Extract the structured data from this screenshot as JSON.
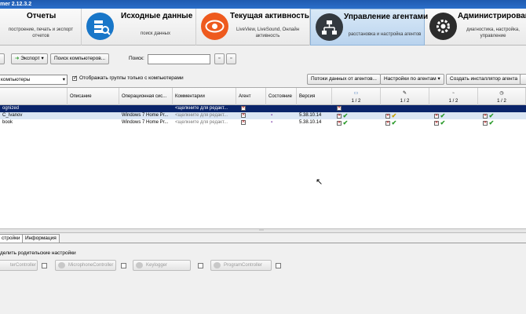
{
  "window": {
    "title": "mer 2.12.3.2"
  },
  "ribbon": {
    "tabs": [
      {
        "title": "Отчеты",
        "subtitle": "построение, печать и экспорт отчетов",
        "icon": "none"
      },
      {
        "title": "Исходные данные",
        "subtitle": "поиск данных",
        "icon": "search-database-icon"
      },
      {
        "title": "Текущая активность",
        "subtitle": "LiveView, LiveSound, Онлайн активность",
        "icon": "eye-icon"
      },
      {
        "title": "Управление агентами",
        "subtitle": "расстановка и настройка агентов",
        "icon": "network-icon",
        "active": true
      },
      {
        "title": "Администрировани",
        "subtitle": "диагностика, настройка, управление",
        "icon": "gear-icon"
      }
    ]
  },
  "toolbar": {
    "export_label": "Экспорт",
    "search_computers_label": "Поиск компьютеров...",
    "search_label": "Поиск:",
    "search_value": "",
    "view_select_value": "компьютеры",
    "show_groups_label": "Отображать группы только с компьютерами",
    "show_groups_checked": true,
    "agent_data_streams_label": "Потоки данных от агентов...",
    "agent_settings_label": "Настройки по агентам",
    "create_installer_label": "Создать инсталлятор агента"
  },
  "table": {
    "columns": [
      "Описание",
      "Операционная сис...",
      "Комментарии",
      "Агент",
      "Состояние",
      "Версия"
    ],
    "icon_columns": [
      {
        "icon": "monitor-icon",
        "count": "1 / 2"
      },
      {
        "icon": "microphone-icon",
        "count": "1 / 2"
      },
      {
        "icon": "keylogger-icon",
        "count": "1 / 2"
      },
      {
        "icon": "clock-icon",
        "count": "1 / 2"
      }
    ],
    "rows": [
      {
        "name": "ognized",
        "description": "",
        "os": "",
        "comment": "<щелкните для редакт...",
        "agent": "",
        "state": "",
        "version": "",
        "selected": true
      },
      {
        "name": "C_Ivanov",
        "description": "",
        "os": "Windows 7 Home Pr...",
        "comment": "<щелкните для редакт...",
        "agent": "x",
        "state": "ok",
        "version": "5.38.10.14"
      },
      {
        "name": "book",
        "description": "",
        "os": "Windows 7 Home Pr...",
        "comment": "<щелкните для редакт...",
        "agent": "x",
        "state": "ok",
        "version": "5.38.10.14"
      }
    ]
  },
  "bottom": {
    "tabs": [
      "стройки",
      "Информация"
    ],
    "inherit_label": "делить родительские настройки",
    "controllers": [
      "terController",
      "MicrophoneController",
      "Keylogger",
      "ProgramController"
    ]
  },
  "colors": {
    "selection": "#0a246a",
    "accent": "#2a6ec9"
  }
}
